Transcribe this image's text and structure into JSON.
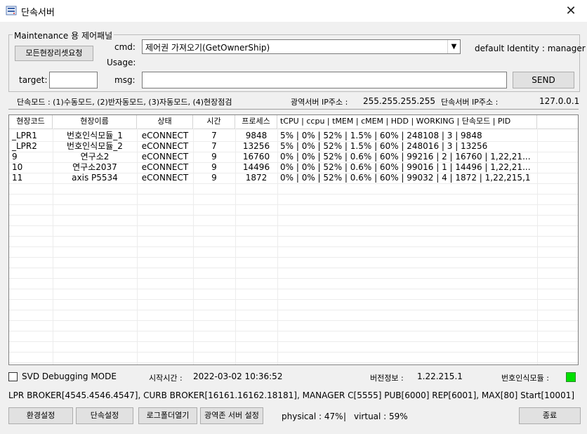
{
  "window": {
    "title": "단속서버",
    "close_glyph": "✕",
    "app_icon": "server-app-icon"
  },
  "maintenance": {
    "legend": "Maintenance 용 제어패널",
    "reset_button": "모든현장리셋요청",
    "cmd_label": "cmd:",
    "cmd_value": "제어권 가져오기(GetOwnerShip)",
    "usage_label": "Usage:",
    "identity_text": "default Identity : manager",
    "target_label": "target:",
    "target_value": "",
    "msg_label": "msg:",
    "msg_value": "",
    "send_button": "SEND"
  },
  "status_line": {
    "modes": "단속모드 : (1)수동모드, (2)반자동모드, (3)자동모드, (4)현장점검",
    "wide_ip_label": "광역서버 IP주소 :",
    "wide_ip": "255.255.255.255",
    "enf_ip_label": "단속서버 IP주소 :",
    "enf_ip": "127.0.0.1"
  },
  "table": {
    "columns": [
      "현장코드",
      "현장이름",
      "상태",
      "시간",
      "프로세스",
      "tCPU | ccpu | tMEM | cMEM | HDD | WORKING | 단속모드 | PID"
    ],
    "rows": [
      [
        "_LPR1",
        "번호인식모듈_1",
        "eCONNECT",
        "7",
        "9848",
        "5% | 0% | 52% | 1.5% | 60% | 248108 | 3 | 9848"
      ],
      [
        "_LPR2",
        "번호인식모듈_2",
        "eCONNECT",
        "7",
        "13256",
        "5% | 0% | 52% | 1.5% | 60% | 248016 | 3 | 13256"
      ],
      [
        "9",
        "연구소2",
        "eCONNECT",
        "9",
        "16760",
        "0% | 0% | 52% | 0.6% | 60% | 99216 | 2 | 16760 | 1,22,21..."
      ],
      [
        "10",
        "연구소2037",
        "eCONNECT",
        "9",
        "14496",
        "0% | 0% | 52% | 0.6% | 60% | 99016 | 1 | 14496 | 1,22,21..."
      ],
      [
        "11",
        "axis P5534",
        "eCONNECT",
        "9",
        "1872",
        "0% | 0% | 52% | 0.6% | 60% | 99032 | 4 | 1872 | 1,22,215,1"
      ]
    ]
  },
  "footer": {
    "svd_label": "SVD Debugging MODE",
    "start_label": "시작시간 :",
    "start_time": "2022-03-02 10:36:52",
    "version_label": "버전정보 :",
    "version": "1.22.215.1",
    "lpr_module_label": "번호인식모듈 :",
    "lpr_status_color": "#00e000",
    "broker_line": "LPR BROKER[4545.4546.4547], CURB BROKER[16161.16162.18181], MANAGER C[5555] PUB[6000] REP[6001], MAX[80] Start[10001]",
    "env_button": "환경설정",
    "enf_button": "단속설정",
    "log_button": "로그폴더열기",
    "region_button": "광역존 서버 설정",
    "physical": "physical : 47%",
    "divider": "|",
    "virtual": "virtual : 59%",
    "exit_button": "종료"
  }
}
